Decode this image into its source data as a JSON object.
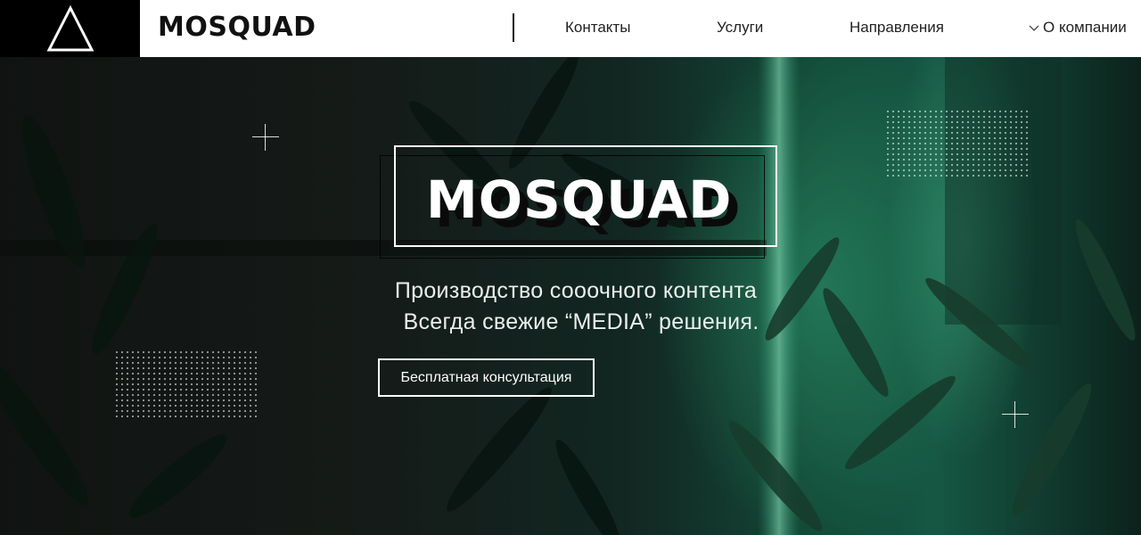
{
  "header": {
    "brand": "MOSQUAD",
    "logo_icon": "triangle-logo-icon",
    "nav": {
      "contacts": "Контакты",
      "services": "Услуги",
      "directions": "Направления",
      "about": "О компании"
    },
    "about_icon": "chevron-down-icon"
  },
  "hero": {
    "title": "MOSQUAD",
    "subtitle_line1": "Производство сооочного контента",
    "subtitle_line2": "Всегда свежие “MEDIA” решения.",
    "cta_label": "Бесплатная консультация"
  },
  "colors": {
    "header_bg": "#ffffff",
    "logo_bg": "#000000",
    "accent_green": "#1b6b52",
    "text_light": "#ffffff"
  }
}
